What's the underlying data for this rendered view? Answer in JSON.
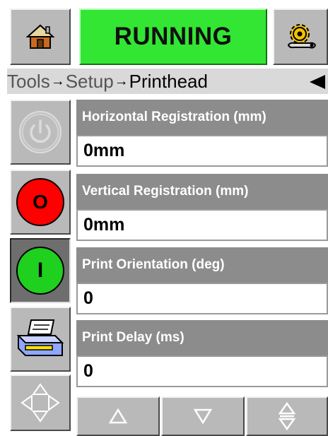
{
  "header": {
    "status_label": "RUNNING",
    "status_color": "#33e633",
    "home_icon": "home-icon",
    "settings_icon": "gear-wrench-icon"
  },
  "breadcrumb": {
    "items": [
      "Tools",
      "Setup",
      "Printhead"
    ],
    "separator": "→",
    "back_icon": "back-arrow-icon"
  },
  "sidebar": {
    "power_icon": "power-icon",
    "stop_label": "O",
    "stop_color": "#ff0000",
    "start_label": "I",
    "start_color": "#1fd01f",
    "printer_icon": "printer-icon",
    "navigate_icon": "four-way-arrows-icon"
  },
  "fields": [
    {
      "label": "Horizontal Registration (mm)",
      "value": "0mm"
    },
    {
      "label": "Vertical Registration (mm)",
      "value": "0mm"
    },
    {
      "label": "Print Orientation (deg)",
      "value": "0"
    },
    {
      "label": "Print Delay (ms)",
      "value": "0"
    }
  ],
  "bottom_bar": {
    "up_icon": "triangle-up-icon",
    "down_icon": "triangle-down-icon",
    "updown_icon": "up-down-icon"
  }
}
